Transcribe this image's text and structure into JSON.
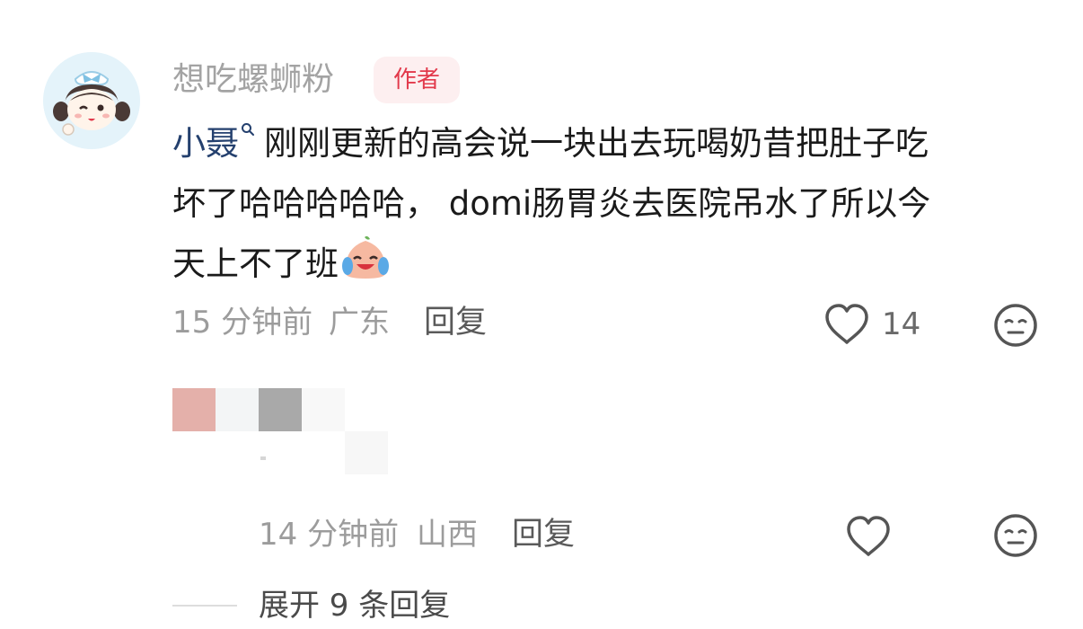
{
  "comment": {
    "username": "想吃螺蛳粉",
    "author_badge": "作者",
    "mention": "小聂",
    "text_line1": "刚刚更新的高会说一块出去玩喝奶昔把肚子吃",
    "text_line2": "坏了哈哈哈哈哈， domi肠胃炎去医院吊水了所以今",
    "text_line3": "天上不了班",
    "time": "15 分钟前",
    "location": "广东",
    "reply_label": "回复",
    "like_count": "14"
  },
  "sub_reply": {
    "time": "14 分钟前",
    "location": "山西",
    "reply_label": "回复"
  },
  "expand_label": "展开 9 条回复",
  "icons": {
    "like": "heart-outline-icon",
    "dislike": "meh-face-icon",
    "mention": "search-icon",
    "emoji": "crying-laughing-face-emoji"
  },
  "colors": {
    "accent": "#e2394b",
    "badge_bg": "#fdeff0",
    "mention": "#24406e",
    "muted_text": "#9c9c9c"
  }
}
